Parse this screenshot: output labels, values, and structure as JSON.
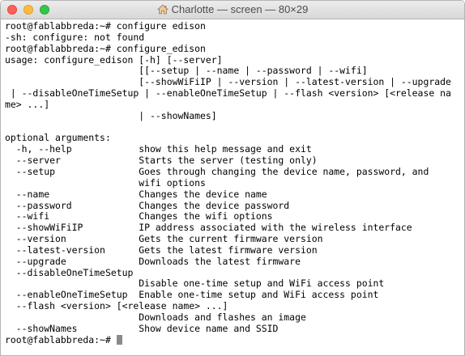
{
  "window": {
    "title": "Charlotte — screen — 80×29",
    "title_icon": "home-icon"
  },
  "terminal": {
    "lines": [
      "root@fablabbreda:~# configure edison",
      "-sh: configure: not found",
      "root@fablabbreda:~# configure_edison",
      "usage: configure_edison [-h] [--server]",
      "                        [[--setup | --name | --password | --wifi]",
      "                        [--showWiFiIP | --version | --latest-version | --upgrade",
      " | --disableOneTimeSetup | --enableOneTimeSetup | --flash <version> [<release na",
      "me> ...]",
      "                        | --showNames]",
      "",
      "optional arguments:",
      "  -h, --help            show this help message and exit",
      "  --server              Starts the server (testing only)",
      "  --setup               Goes through changing the device name, password, and",
      "                        wifi options",
      "  --name                Changes the device name",
      "  --password            Changes the device password",
      "  --wifi                Changes the wifi options",
      "  --showWiFiIP          IP address associated with the wireless interface",
      "  --version             Gets the current firmware version",
      "  --latest-version      Gets the latest firmware version",
      "  --upgrade             Downloads the latest firmware",
      "  --disableOneTimeSetup",
      "                        Disable one-time setup and WiFi access point",
      "  --enableOneTimeSetup  Enable one-time setup and WiFi access point",
      "  --flash <version> [<release name> ...]",
      "                        Downloads and flashes an image",
      "  --showNames           Show device name and SSID"
    ],
    "prompt": "root@fablabbreda:~# "
  },
  "colors": {
    "close": "#fc605c",
    "minimize": "#fdbc40",
    "maximize": "#34c84a",
    "background": "#ffffff",
    "text": "#000000",
    "cursor": "#8a8a8a"
  }
}
